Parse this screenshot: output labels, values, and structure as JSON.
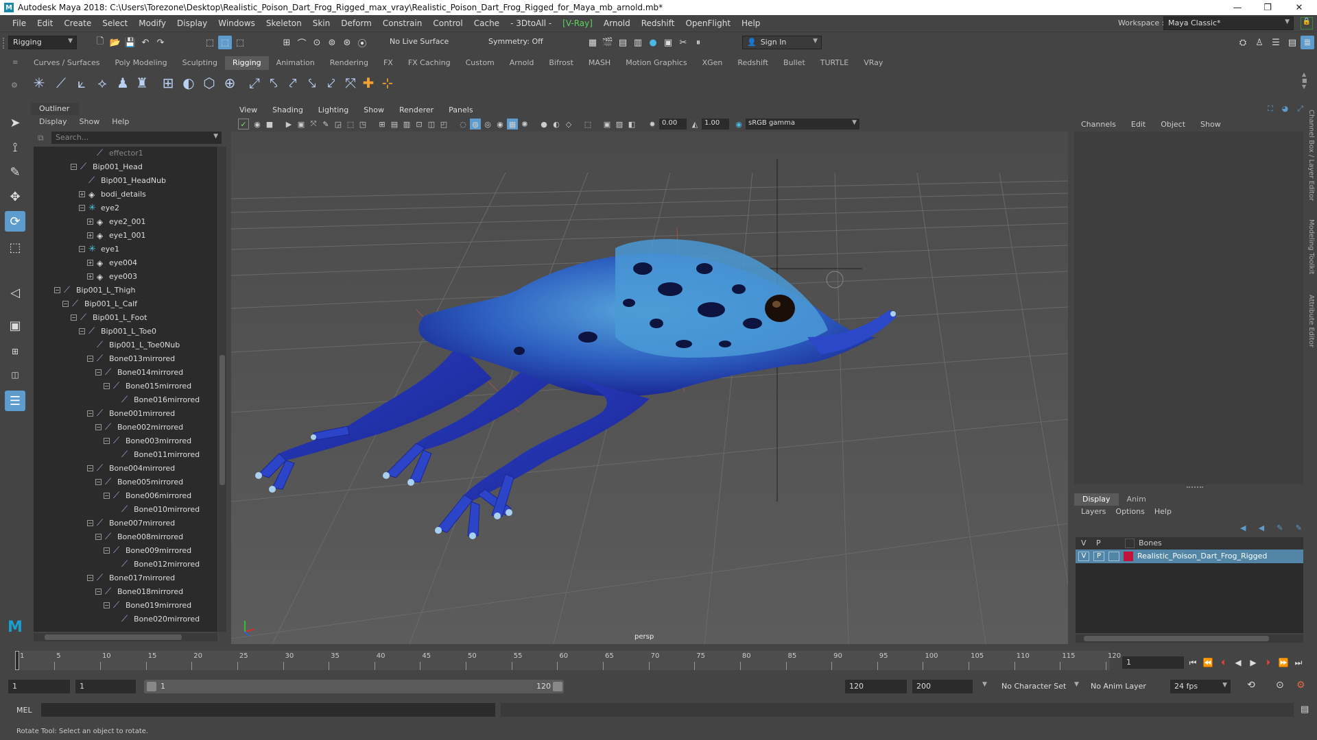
{
  "window": {
    "title": "Autodesk Maya 2018: C:\\Users\\Torezone\\Desktop\\Realistic_Poison_Dart_Frog_Rigged_max_vray\\Realistic_Poison_Dart_Frog_Rigged_for_Maya_mb_arnold.mb*",
    "minimize": "—",
    "restore": "❐",
    "close": "✕"
  },
  "menubar": {
    "items": [
      "File",
      "Edit",
      "Create",
      "Select",
      "Modify",
      "Display",
      "Windows",
      "Skeleton",
      "Skin",
      "Deform",
      "Constrain",
      "Control",
      "Cache",
      "- 3DtoAll -",
      "[V-Ray]",
      "Arnold",
      "Redshift",
      "OpenFlight",
      "Help"
    ],
    "workspace_label": "Workspace :",
    "workspace_value": "Maya Classic*"
  },
  "statusline": {
    "mode": "Rigging",
    "live_surface": "No Live Surface",
    "symmetry": "Symmetry: Off",
    "sign_in": "Sign In"
  },
  "shelf": {
    "tabs": [
      "Curves / Surfaces",
      "Poly Modeling",
      "Sculpting",
      "Rigging",
      "Animation",
      "Rendering",
      "FX",
      "FX Caching",
      "Custom",
      "Arnold",
      "Bifrost",
      "MASH",
      "Motion Graphics",
      "XGen",
      "Redshift",
      "Bullet",
      "TURTLE",
      "VRay"
    ],
    "active": "Rigging"
  },
  "outliner": {
    "title": "Outliner",
    "menus": [
      "Display",
      "Show",
      "Help"
    ],
    "search_placeholder": "Search...",
    "rows": [
      {
        "label": "effector1",
        "depth": 5,
        "icon": "joint",
        "exp": "",
        "dim": true
      },
      {
        "label": "Bip001_Head",
        "depth": 3,
        "icon": "joint",
        "exp": "-"
      },
      {
        "label": "Bip001_HeadNub",
        "depth": 4,
        "icon": "joint",
        "exp": ""
      },
      {
        "label": "bodi_details",
        "depth": 4,
        "icon": "mesh",
        "exp": "+"
      },
      {
        "label": "eye2",
        "depth": 4,
        "icon": "group",
        "exp": "-"
      },
      {
        "label": "eye2_001",
        "depth": 5,
        "icon": "mesh",
        "exp": "+"
      },
      {
        "label": "eye1_001",
        "depth": 5,
        "icon": "mesh",
        "exp": "+"
      },
      {
        "label": "eye1",
        "depth": 4,
        "icon": "group",
        "exp": "-"
      },
      {
        "label": "eye004",
        "depth": 5,
        "icon": "mesh",
        "exp": "+"
      },
      {
        "label": "eye003",
        "depth": 5,
        "icon": "mesh",
        "exp": "+"
      },
      {
        "label": "Bip001_L_Thigh",
        "depth": 1,
        "icon": "joint",
        "exp": "-"
      },
      {
        "label": "Bip001_L_Calf",
        "depth": 2,
        "icon": "joint",
        "exp": "-"
      },
      {
        "label": "Bip001_L_Foot",
        "depth": 3,
        "icon": "joint",
        "exp": "-"
      },
      {
        "label": "Bip001_L_Toe0",
        "depth": 4,
        "icon": "joint",
        "exp": "-"
      },
      {
        "label": "Bip001_L_Toe0Nub",
        "depth": 5,
        "icon": "joint",
        "exp": ""
      },
      {
        "label": "Bone013mirrored",
        "depth": 5,
        "icon": "joint",
        "exp": "-"
      },
      {
        "label": "Bone014mirrored",
        "depth": 6,
        "icon": "joint",
        "exp": "-"
      },
      {
        "label": "Bone015mirrored",
        "depth": 7,
        "icon": "joint",
        "exp": "-"
      },
      {
        "label": "Bone016mirrored",
        "depth": 8,
        "icon": "joint",
        "exp": ""
      },
      {
        "label": "Bone001mirrored",
        "depth": 5,
        "icon": "joint",
        "exp": "-"
      },
      {
        "label": "Bone002mirrored",
        "depth": 6,
        "icon": "joint",
        "exp": "-"
      },
      {
        "label": "Bone003mirrored",
        "depth": 7,
        "icon": "joint",
        "exp": "-"
      },
      {
        "label": "Bone011mirrored",
        "depth": 8,
        "icon": "joint",
        "exp": ""
      },
      {
        "label": "Bone004mirrored",
        "depth": 5,
        "icon": "joint",
        "exp": "-"
      },
      {
        "label": "Bone005mirrored",
        "depth": 6,
        "icon": "joint",
        "exp": "-"
      },
      {
        "label": "Bone006mirrored",
        "depth": 7,
        "icon": "joint",
        "exp": "-"
      },
      {
        "label": "Bone010mirrored",
        "depth": 8,
        "icon": "joint",
        "exp": ""
      },
      {
        "label": "Bone007mirrored",
        "depth": 5,
        "icon": "joint",
        "exp": "-"
      },
      {
        "label": "Bone008mirrored",
        "depth": 6,
        "icon": "joint",
        "exp": "-"
      },
      {
        "label": "Bone009mirrored",
        "depth": 7,
        "icon": "joint",
        "exp": "-"
      },
      {
        "label": "Bone012mirrored",
        "depth": 8,
        "icon": "joint",
        "exp": ""
      },
      {
        "label": "Bone017mirrored",
        "depth": 5,
        "icon": "joint",
        "exp": "-"
      },
      {
        "label": "Bone018mirrored",
        "depth": 6,
        "icon": "joint",
        "exp": "-"
      },
      {
        "label": "Bone019mirrored",
        "depth": 7,
        "icon": "joint",
        "exp": "-"
      },
      {
        "label": "Bone020mirrored",
        "depth": 8,
        "icon": "joint",
        "exp": ""
      }
    ]
  },
  "viewport": {
    "menus": [
      "View",
      "Shading",
      "Lighting",
      "Show",
      "Renderer",
      "Panels"
    ],
    "exposure": "0.00",
    "gamma": "1.00",
    "color_space": "sRGB gamma",
    "camera": "persp"
  },
  "channelbox": {
    "menus": [
      "Channels",
      "Edit",
      "Object",
      "Show"
    ],
    "side_tabs": [
      "Channel Box / Layer Editor",
      "Modeling Toolkit",
      "Attribute Editor"
    ]
  },
  "layers": {
    "tabs": [
      "Display",
      "Anim"
    ],
    "menus": [
      "Layers",
      "Options",
      "Help"
    ],
    "header": {
      "v": "V",
      "p": "P",
      "name": "Bones"
    },
    "row": {
      "v": "V",
      "p": "P",
      "name": "Realistic_Poison_Dart_Frog_Rigged",
      "color": "#c0143c"
    }
  },
  "timeline": {
    "ticks": [
      1,
      5,
      10,
      15,
      20,
      25,
      30,
      35,
      40,
      45,
      50,
      55,
      60,
      65,
      70,
      75,
      80,
      85,
      90,
      95,
      100,
      105,
      110,
      115,
      120
    ],
    "current_frame": "1"
  },
  "range": {
    "start": "1",
    "inner_start": "1",
    "slider_start": "1",
    "slider_end": "120",
    "end": "120",
    "max": "200",
    "character_set": "No Character Set",
    "anim_layer": "No Anim Layer",
    "fps": "24 fps"
  },
  "cmdline": {
    "label": "MEL"
  },
  "helpline": {
    "text": "Rotate Tool: Select an object to rotate."
  },
  "colors": {
    "frog_blue": "#1f2fb0",
    "frog_light": "#4aa0d8",
    "accent": "#5d9ccc",
    "selected_row": "#5285a6"
  }
}
